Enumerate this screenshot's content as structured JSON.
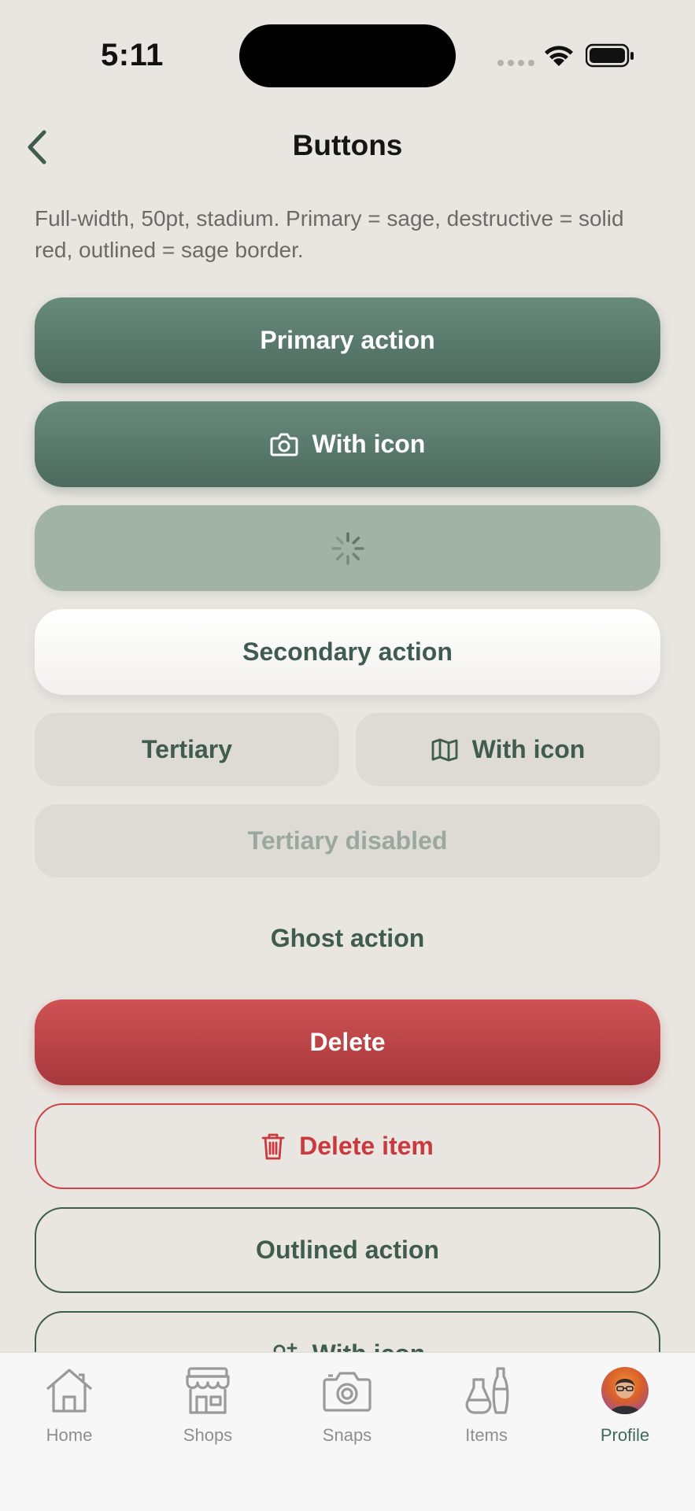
{
  "status_bar": {
    "time": "5:11"
  },
  "nav": {
    "title": "Buttons"
  },
  "description": "Full-width, 50pt, stadium. Primary = sage, destructive = solid red, outlined = sage border.",
  "buttons": {
    "primary": "Primary action",
    "primary_with_icon": "With icon",
    "secondary": "Secondary action",
    "tertiary": "Tertiary",
    "tertiary_with_icon": "With icon",
    "tertiary_disabled": "Tertiary disabled",
    "ghost": "Ghost action",
    "delete": "Delete",
    "delete_item": "Delete item",
    "outlined": "Outlined action",
    "outlined_with_icon": "With icon"
  },
  "tabs": [
    {
      "label": "Home",
      "icon": "house-icon"
    },
    {
      "label": "Shops",
      "icon": "storefront-icon"
    },
    {
      "label": "Snaps",
      "icon": "camera-icon"
    },
    {
      "label": "Items",
      "icon": "vases-icon"
    },
    {
      "label": "Profile",
      "icon": "avatar",
      "active": true
    }
  ],
  "colors": {
    "sage": "#4f6d60",
    "destructive": "#c9393d",
    "background": "#e9e6e1",
    "active_tab": "#3f6b59"
  }
}
